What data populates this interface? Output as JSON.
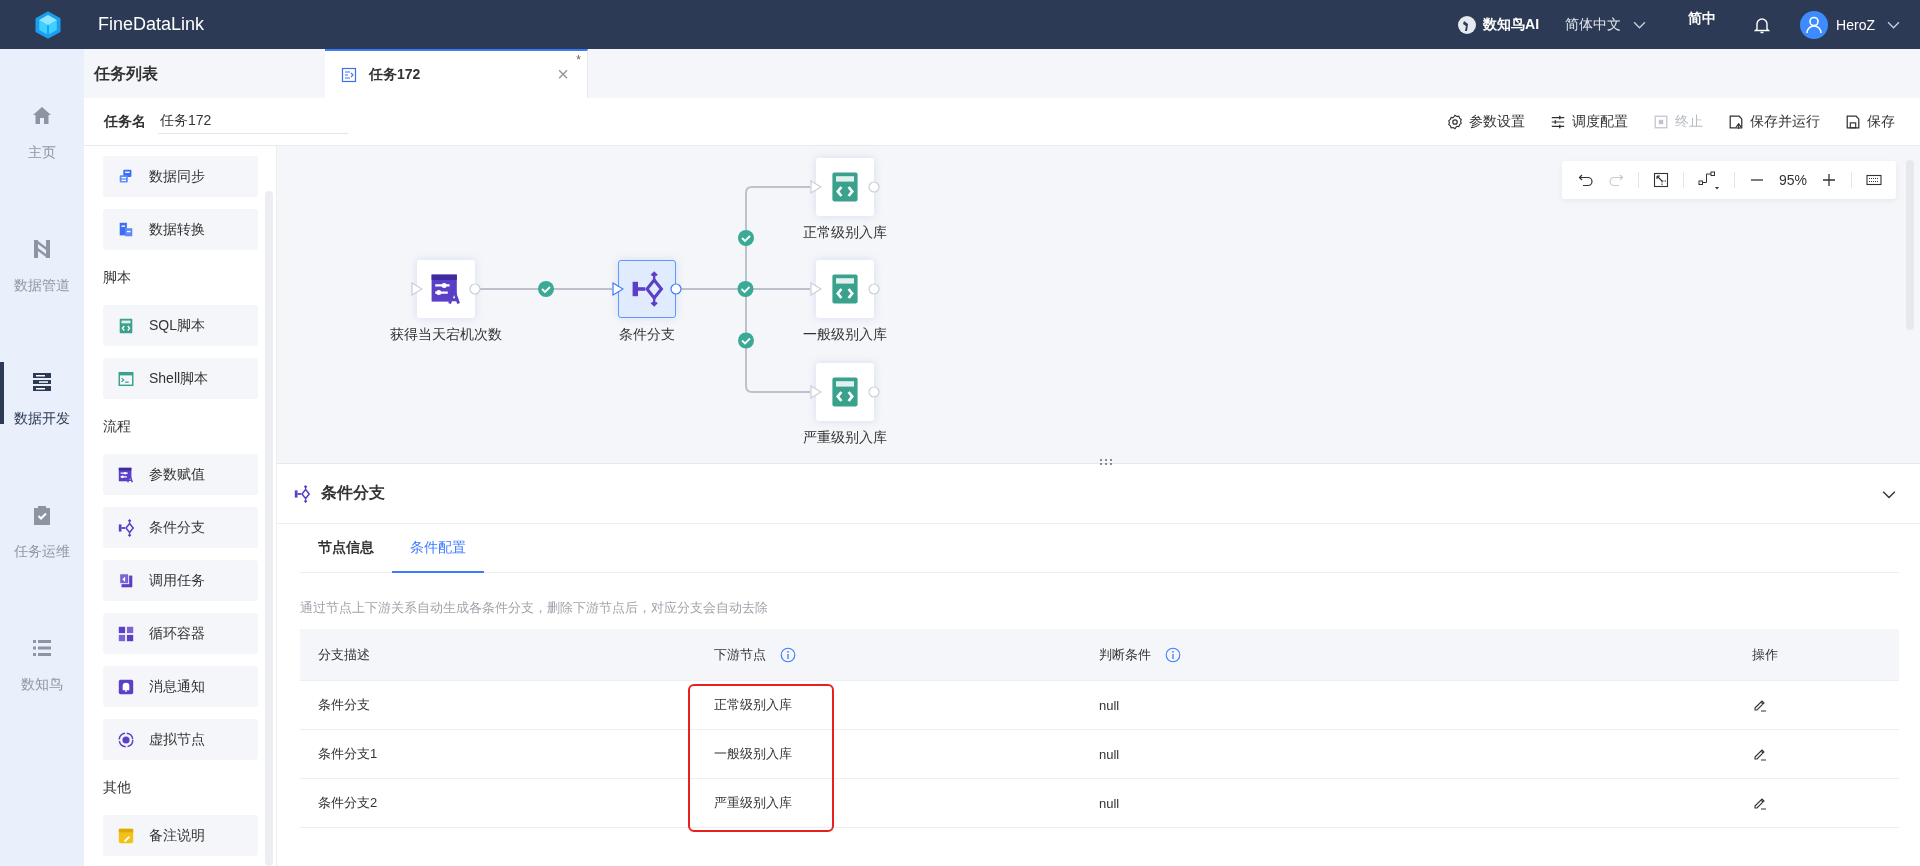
{
  "app": {
    "name": "FineDataLink"
  },
  "header": {
    "ai_label": "数知鸟AI",
    "language": "简体中文",
    "short_language": "简中",
    "user": "HeroZ"
  },
  "nav": [
    {
      "kind": "home",
      "label": "主页",
      "selected": false
    },
    {
      "kind": "pipeline",
      "label": "数据管道",
      "selected": false
    },
    {
      "kind": "dev",
      "label": "数据开发",
      "selected": true
    },
    {
      "kind": "ops",
      "label": "任务运维",
      "selected": false
    },
    {
      "kind": "bird",
      "label": "数知鸟",
      "selected": false
    }
  ],
  "task_list_title": "任务列表",
  "tabs": [
    {
      "label": "任务172",
      "selected": true,
      "close": "×",
      "modified": "*"
    }
  ],
  "task_name": {
    "label": "任务名",
    "value": "任务172"
  },
  "toolbar": [
    {
      "kind": "gear",
      "label": "参数设置",
      "disabled": false
    },
    {
      "kind": "sliders",
      "label": "调度配置",
      "disabled": false
    },
    {
      "kind": "stop",
      "label": "终止",
      "disabled": true
    },
    {
      "kind": "save-run",
      "label": "保存并运行",
      "disabled": false
    },
    {
      "kind": "save",
      "label": "保存",
      "disabled": false
    }
  ],
  "palette": [
    {
      "kind": "sync",
      "label": "数据同步"
    },
    {
      "kind": "transform",
      "label": "数据转换"
    },
    {
      "kind": "heading",
      "label": "脚本"
    },
    {
      "kind": "sql",
      "label": "SQL脚本"
    },
    {
      "kind": "shell",
      "label": "Shell脚本"
    },
    {
      "kind": "heading",
      "label": "流程"
    },
    {
      "kind": "assign",
      "label": "参数赋值"
    },
    {
      "kind": "branch",
      "label": "条件分支"
    },
    {
      "kind": "call",
      "label": "调用任务"
    },
    {
      "kind": "loop",
      "label": "循环容器"
    },
    {
      "kind": "notify",
      "label": "消息通知"
    },
    {
      "kind": "virtual",
      "label": "虚拟节点"
    },
    {
      "kind": "heading",
      "label": "其他"
    },
    {
      "kind": "note",
      "label": "备注说明"
    }
  ],
  "canvas": {
    "zoom": "95%",
    "nodes": [
      {
        "kind": "assign",
        "label": "获得当天宕机次数",
        "selected": false
      },
      {
        "kind": "branch",
        "label": "条件分支",
        "selected": true
      },
      {
        "kind": "sql",
        "label": "正常级别入库",
        "selected": false
      },
      {
        "kind": "sql",
        "label": "一般级别入库",
        "selected": false
      },
      {
        "kind": "sql",
        "label": "严重级别入库",
        "selected": false
      }
    ],
    "edges": [
      {
        "success": true
      },
      {
        "success": true
      },
      {
        "success": true
      },
      {
        "success": true
      }
    ]
  },
  "panel": {
    "title": "条件分支",
    "tabs": [
      {
        "label": "节点信息",
        "selected": false
      },
      {
        "label": "条件配置",
        "selected": true
      }
    ],
    "note": "通过节点上下游关系自动生成各条件分支，删除下游节点后，对应分支会自动去除",
    "columns": [
      {
        "label": "分支描述",
        "info": false,
        "highlighted": false
      },
      {
        "label": "下游节点",
        "info": true,
        "highlighted": true
      },
      {
        "label": "判断条件",
        "info": true,
        "highlighted": false
      },
      {
        "label": "操作",
        "info": false,
        "highlighted": false
      }
    ],
    "rows": [
      {
        "description": "条件分支",
        "downstream": "正常级别入库",
        "condition": "null"
      },
      {
        "description": "条件分支1",
        "downstream": "一般级别入库",
        "condition": "null"
      },
      {
        "description": "条件分支2",
        "downstream": "严重级别入库",
        "condition": "null"
      }
    ]
  }
}
